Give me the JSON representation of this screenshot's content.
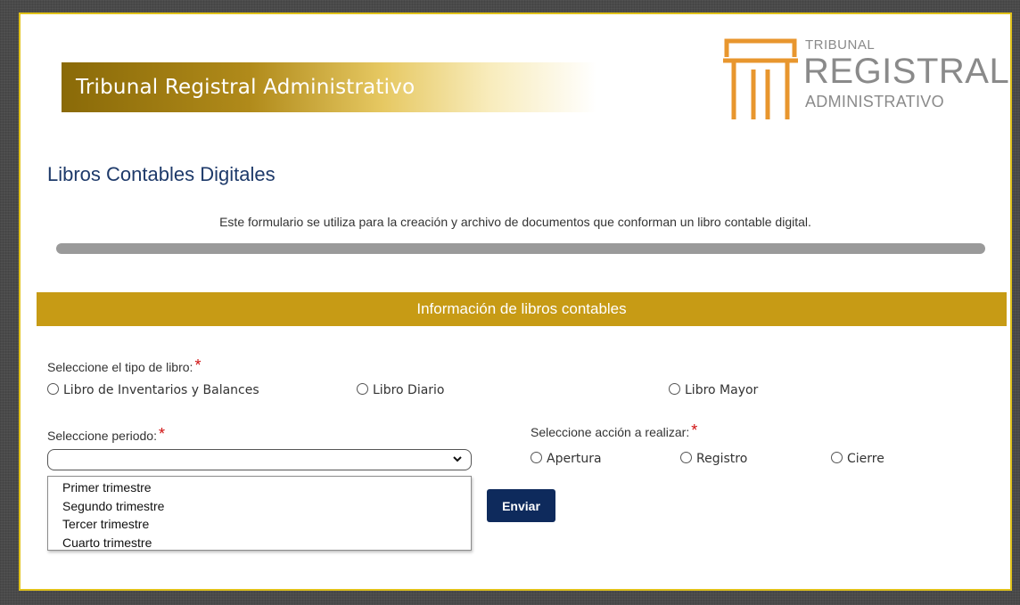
{
  "header": {
    "banner_title": "Tribunal Registral Administrativo",
    "logo": {
      "line1": "TRIBUNAL",
      "line2": "REGISTRAL",
      "line3": "ADMINISTRATIVO",
      "icon": "pillar-logo-icon"
    }
  },
  "page": {
    "title": "Libros Contables Digitales",
    "description": "Este formulario se utiliza para la creación y archivo de documentos que conforman un libro contable digital."
  },
  "section": {
    "title": "Información de libros contables"
  },
  "form": {
    "tipo_libro": {
      "label": "Seleccione el tipo de libro:",
      "required_mark": "*",
      "options": [
        "Libro de Inventarios y Balances",
        "Libro Diario",
        "Libro Mayor"
      ]
    },
    "periodo": {
      "label": "Seleccione periodo:",
      "required_mark": "*",
      "selected_value": "",
      "options": [
        "Primer trimestre",
        "Segundo trimestre",
        "Tercer trimestre",
        "Cuarto trimestre"
      ]
    },
    "accion": {
      "label": "Seleccione acción a realizar:",
      "required_mark": "*",
      "options": [
        "Apertura",
        "Registro",
        "Cierre"
      ]
    },
    "submit_label": "Enviar"
  },
  "colors": {
    "gold": "#c79b15",
    "navy_button": "#0e2a5c",
    "title_blue": "#1e3a6a",
    "frame_border": "#e1c21a",
    "required_red": "#d01010"
  }
}
